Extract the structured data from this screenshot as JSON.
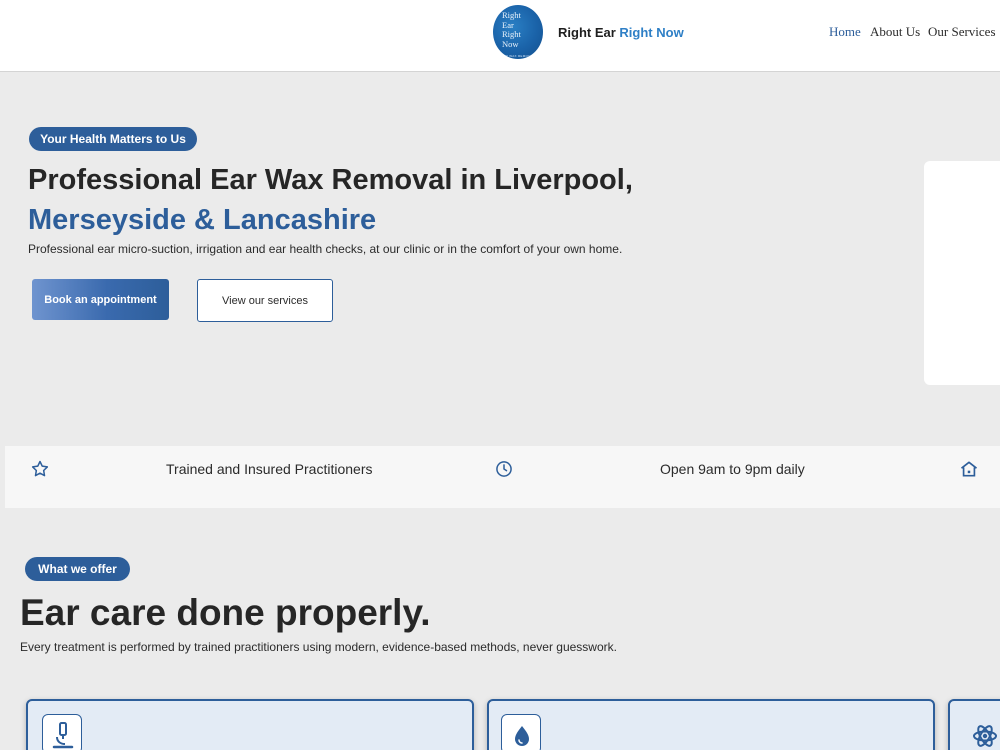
{
  "header": {
    "logo_lines": [
      "Right",
      "Ear",
      "Right",
      "Now"
    ],
    "logo_subtext": "EAR WAX REMOVAL",
    "brand_main": "Right Ear",
    "brand_accent": "Right Now",
    "nav": [
      "Home",
      "About Us",
      "Our Services"
    ],
    "active_nav": "Home"
  },
  "hero": {
    "badge": "Your Health Matters to Us",
    "title_line1": "Professional Ear Wax Removal in Liverpool,",
    "title_line2": "Merseyside & Lancashire",
    "subtitle": "Professional ear micro-suction, irrigation and ear health checks, at our clinic or in the comfort of your own home.",
    "primary_button": "Book an appointment",
    "secondary_button": "View our services"
  },
  "features": [
    {
      "icon": "star-icon",
      "text": "Trained and Insured Practitioners"
    },
    {
      "icon": "clock-icon",
      "text": "Open 9am to 9pm daily"
    },
    {
      "icon": "home-icon",
      "text": ""
    }
  ],
  "offer": {
    "badge": "What we offer",
    "title": "Ear care done properly.",
    "subtitle": "Every treatment is performed by trained practitioners using modern, evidence-based methods, never guesswork.",
    "cards": [
      {
        "icon": "microscope-icon"
      },
      {
        "icon": "water-drop-icon"
      },
      {
        "icon": "atom-icon"
      }
    ]
  },
  "colors": {
    "primary": "#2d5e9a",
    "accent": "#2e7fc6",
    "background": "#ebebeb",
    "card_background": "#e3ebf5"
  }
}
